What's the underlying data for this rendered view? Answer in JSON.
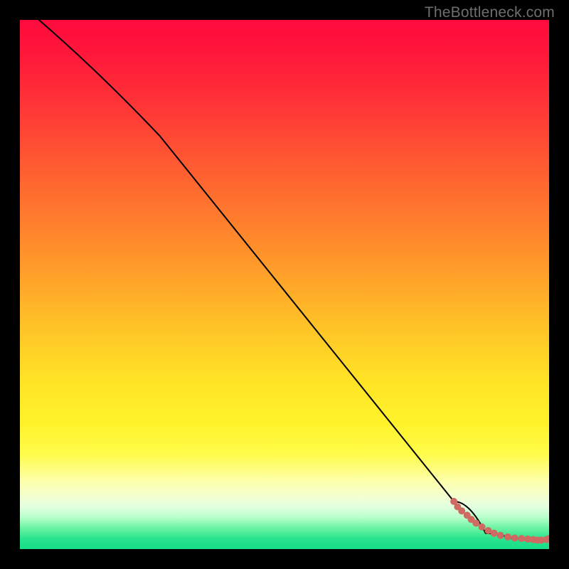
{
  "watermark": "TheBottleneck.com",
  "colors": {
    "dot": "#cf6a62",
    "line": "#000000"
  },
  "chart_data": {
    "type": "line",
    "title": "",
    "xlabel": "",
    "ylabel": "",
    "xlim": [
      0,
      100
    ],
    "ylim": [
      0,
      100
    ],
    "grid": false,
    "series": [
      {
        "name": "curve",
        "x": [
          3.6,
          26.5,
          82.0,
          88.0,
          93.0,
          98.0,
          100.0
        ],
        "y": [
          100.0,
          78.0,
          9.0,
          3.0,
          2.0,
          1.8,
          2.0
        ],
        "style": "line",
        "color": "#000000"
      },
      {
        "name": "dots",
        "x": [
          82.0,
          82.7,
          83.5,
          84.5,
          85.3,
          86.2,
          87.3,
          88.5,
          89.6,
          90.8,
          92.2,
          93.5,
          94.8,
          96.0,
          97.0,
          97.8,
          98.5,
          99.5,
          100.0
        ],
        "y": [
          9.0,
          8.0,
          7.2,
          6.4,
          5.6,
          4.9,
          4.2,
          3.5,
          3.0,
          2.6,
          2.3,
          2.1,
          2.0,
          1.9,
          1.8,
          1.7,
          1.7,
          1.8,
          2.0
        ],
        "style": "scatter",
        "color": "#cf6a62",
        "marker_size": 5
      }
    ],
    "note": "Axes are unlabelled; x and y expressed as 0–100 fractions of the plot area (x left→right, y bottom→top). Values estimated from pixel positions."
  }
}
